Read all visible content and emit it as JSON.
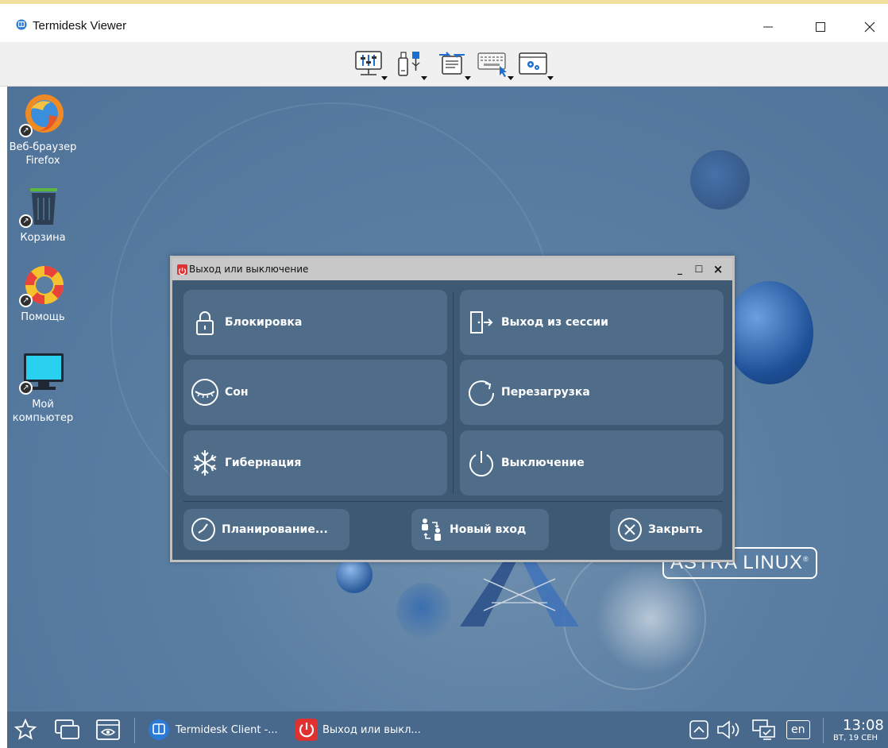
{
  "window": {
    "title": "Termidesk Viewer",
    "minimize_glyph": "—",
    "maximize_glyph": "☐",
    "close_glyph": "✕"
  },
  "toolbar": {
    "items": [
      {
        "icon": "display-settings-icon"
      },
      {
        "icon": "usb-devices-icon"
      },
      {
        "icon": "clipboard-transfer-icon"
      },
      {
        "icon": "keyboard-icon"
      },
      {
        "icon": "settings-window-icon"
      }
    ]
  },
  "desktop": {
    "icons": [
      {
        "label": "Веб-браузер Firefox",
        "icon": "firefox-icon"
      },
      {
        "label": "Корзина",
        "icon": "trash-icon"
      },
      {
        "label": "Помощь",
        "icon": "lifebuoy-icon"
      },
      {
        "label": "Мой компьютер",
        "icon": "computer-icon"
      }
    ],
    "logo_text": "ASTRA LINUX",
    "logo_mark": "®"
  },
  "dialog": {
    "title": "Выход или выключение",
    "controls": {
      "minimize": "_",
      "maximize": "☐",
      "close": "×"
    },
    "buttons": {
      "lock": "Блокировка",
      "logout": "Выход из сессии",
      "sleep": "Сон",
      "reboot": "Перезагрузка",
      "hibernate": "Гибернация",
      "shutdown": "Выключение",
      "schedule": "Планирование...",
      "new_login": "Новый вход",
      "close": "Закрыть"
    }
  },
  "taskbar": {
    "tasks": [
      {
        "label": "Termidesk Client -...",
        "icon": "termidesk-icon"
      },
      {
        "label": "Выход или выкл...",
        "icon": "power-icon"
      }
    ],
    "language": "en",
    "clock_time": "13:08",
    "clock_date": "ВТ, 19 СЕН"
  },
  "colors": {
    "desktop_bg": "#5b7fa3",
    "dialog_bg": "#3d5973",
    "dialog_button": "#4f6d89",
    "taskbar_bg": "#48698c",
    "power_red": "#e03030"
  }
}
